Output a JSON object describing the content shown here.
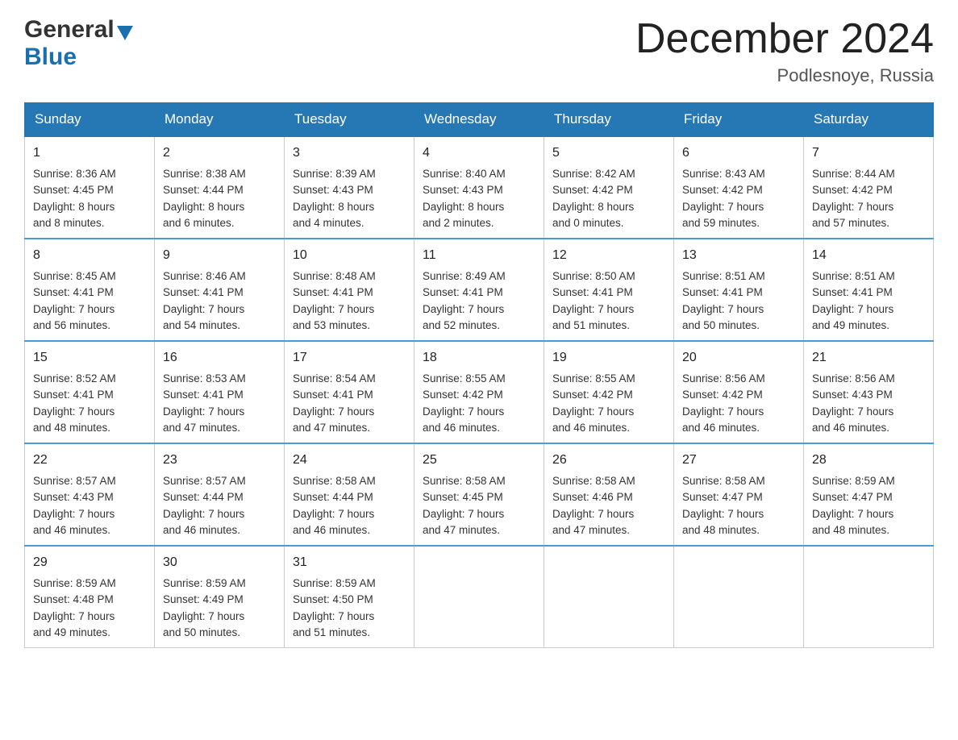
{
  "header": {
    "logo_general": "General",
    "logo_blue": "Blue",
    "title": "December 2024",
    "subtitle": "Podlesnoye, Russia"
  },
  "columns": [
    "Sunday",
    "Monday",
    "Tuesday",
    "Wednesday",
    "Thursday",
    "Friday",
    "Saturday"
  ],
  "weeks": [
    [
      {
        "day": "1",
        "sunrise": "Sunrise: 8:36 AM",
        "sunset": "Sunset: 4:45 PM",
        "daylight": "Daylight: 8 hours",
        "minutes": "and 8 minutes."
      },
      {
        "day": "2",
        "sunrise": "Sunrise: 8:38 AM",
        "sunset": "Sunset: 4:44 PM",
        "daylight": "Daylight: 8 hours",
        "minutes": "and 6 minutes."
      },
      {
        "day": "3",
        "sunrise": "Sunrise: 8:39 AM",
        "sunset": "Sunset: 4:43 PM",
        "daylight": "Daylight: 8 hours",
        "minutes": "and 4 minutes."
      },
      {
        "day": "4",
        "sunrise": "Sunrise: 8:40 AM",
        "sunset": "Sunset: 4:43 PM",
        "daylight": "Daylight: 8 hours",
        "minutes": "and 2 minutes."
      },
      {
        "day": "5",
        "sunrise": "Sunrise: 8:42 AM",
        "sunset": "Sunset: 4:42 PM",
        "daylight": "Daylight: 8 hours",
        "minutes": "and 0 minutes."
      },
      {
        "day": "6",
        "sunrise": "Sunrise: 8:43 AM",
        "sunset": "Sunset: 4:42 PM",
        "daylight": "Daylight: 7 hours",
        "minutes": "and 59 minutes."
      },
      {
        "day": "7",
        "sunrise": "Sunrise: 8:44 AM",
        "sunset": "Sunset: 4:42 PM",
        "daylight": "Daylight: 7 hours",
        "minutes": "and 57 minutes."
      }
    ],
    [
      {
        "day": "8",
        "sunrise": "Sunrise: 8:45 AM",
        "sunset": "Sunset: 4:41 PM",
        "daylight": "Daylight: 7 hours",
        "minutes": "and 56 minutes."
      },
      {
        "day": "9",
        "sunrise": "Sunrise: 8:46 AM",
        "sunset": "Sunset: 4:41 PM",
        "daylight": "Daylight: 7 hours",
        "minutes": "and 54 minutes."
      },
      {
        "day": "10",
        "sunrise": "Sunrise: 8:48 AM",
        "sunset": "Sunset: 4:41 PM",
        "daylight": "Daylight: 7 hours",
        "minutes": "and 53 minutes."
      },
      {
        "day": "11",
        "sunrise": "Sunrise: 8:49 AM",
        "sunset": "Sunset: 4:41 PM",
        "daylight": "Daylight: 7 hours",
        "minutes": "and 52 minutes."
      },
      {
        "day": "12",
        "sunrise": "Sunrise: 8:50 AM",
        "sunset": "Sunset: 4:41 PM",
        "daylight": "Daylight: 7 hours",
        "minutes": "and 51 minutes."
      },
      {
        "day": "13",
        "sunrise": "Sunrise: 8:51 AM",
        "sunset": "Sunset: 4:41 PM",
        "daylight": "Daylight: 7 hours",
        "minutes": "and 50 minutes."
      },
      {
        "day": "14",
        "sunrise": "Sunrise: 8:51 AM",
        "sunset": "Sunset: 4:41 PM",
        "daylight": "Daylight: 7 hours",
        "minutes": "and 49 minutes."
      }
    ],
    [
      {
        "day": "15",
        "sunrise": "Sunrise: 8:52 AM",
        "sunset": "Sunset: 4:41 PM",
        "daylight": "Daylight: 7 hours",
        "minutes": "and 48 minutes."
      },
      {
        "day": "16",
        "sunrise": "Sunrise: 8:53 AM",
        "sunset": "Sunset: 4:41 PM",
        "daylight": "Daylight: 7 hours",
        "minutes": "and 47 minutes."
      },
      {
        "day": "17",
        "sunrise": "Sunrise: 8:54 AM",
        "sunset": "Sunset: 4:41 PM",
        "daylight": "Daylight: 7 hours",
        "minutes": "and 47 minutes."
      },
      {
        "day": "18",
        "sunrise": "Sunrise: 8:55 AM",
        "sunset": "Sunset: 4:42 PM",
        "daylight": "Daylight: 7 hours",
        "minutes": "and 46 minutes."
      },
      {
        "day": "19",
        "sunrise": "Sunrise: 8:55 AM",
        "sunset": "Sunset: 4:42 PM",
        "daylight": "Daylight: 7 hours",
        "minutes": "and 46 minutes."
      },
      {
        "day": "20",
        "sunrise": "Sunrise: 8:56 AM",
        "sunset": "Sunset: 4:42 PM",
        "daylight": "Daylight: 7 hours",
        "minutes": "and 46 minutes."
      },
      {
        "day": "21",
        "sunrise": "Sunrise: 8:56 AM",
        "sunset": "Sunset: 4:43 PM",
        "daylight": "Daylight: 7 hours",
        "minutes": "and 46 minutes."
      }
    ],
    [
      {
        "day": "22",
        "sunrise": "Sunrise: 8:57 AM",
        "sunset": "Sunset: 4:43 PM",
        "daylight": "Daylight: 7 hours",
        "minutes": "and 46 minutes."
      },
      {
        "day": "23",
        "sunrise": "Sunrise: 8:57 AM",
        "sunset": "Sunset: 4:44 PM",
        "daylight": "Daylight: 7 hours",
        "minutes": "and 46 minutes."
      },
      {
        "day": "24",
        "sunrise": "Sunrise: 8:58 AM",
        "sunset": "Sunset: 4:44 PM",
        "daylight": "Daylight: 7 hours",
        "minutes": "and 46 minutes."
      },
      {
        "day": "25",
        "sunrise": "Sunrise: 8:58 AM",
        "sunset": "Sunset: 4:45 PM",
        "daylight": "Daylight: 7 hours",
        "minutes": "and 47 minutes."
      },
      {
        "day": "26",
        "sunrise": "Sunrise: 8:58 AM",
        "sunset": "Sunset: 4:46 PM",
        "daylight": "Daylight: 7 hours",
        "minutes": "and 47 minutes."
      },
      {
        "day": "27",
        "sunrise": "Sunrise: 8:58 AM",
        "sunset": "Sunset: 4:47 PM",
        "daylight": "Daylight: 7 hours",
        "minutes": "and 48 minutes."
      },
      {
        "day": "28",
        "sunrise": "Sunrise: 8:59 AM",
        "sunset": "Sunset: 4:47 PM",
        "daylight": "Daylight: 7 hours",
        "minutes": "and 48 minutes."
      }
    ],
    [
      {
        "day": "29",
        "sunrise": "Sunrise: 8:59 AM",
        "sunset": "Sunset: 4:48 PM",
        "daylight": "Daylight: 7 hours",
        "minutes": "and 49 minutes."
      },
      {
        "day": "30",
        "sunrise": "Sunrise: 8:59 AM",
        "sunset": "Sunset: 4:49 PM",
        "daylight": "Daylight: 7 hours",
        "minutes": "and 50 minutes."
      },
      {
        "day": "31",
        "sunrise": "Sunrise: 8:59 AM",
        "sunset": "Sunset: 4:50 PM",
        "daylight": "Daylight: 7 hours",
        "minutes": "and 51 minutes."
      },
      {
        "day": "",
        "sunrise": "",
        "sunset": "",
        "daylight": "",
        "minutes": ""
      },
      {
        "day": "",
        "sunrise": "",
        "sunset": "",
        "daylight": "",
        "minutes": ""
      },
      {
        "day": "",
        "sunrise": "",
        "sunset": "",
        "daylight": "",
        "minutes": ""
      },
      {
        "day": "",
        "sunrise": "",
        "sunset": "",
        "daylight": "",
        "minutes": ""
      }
    ]
  ]
}
